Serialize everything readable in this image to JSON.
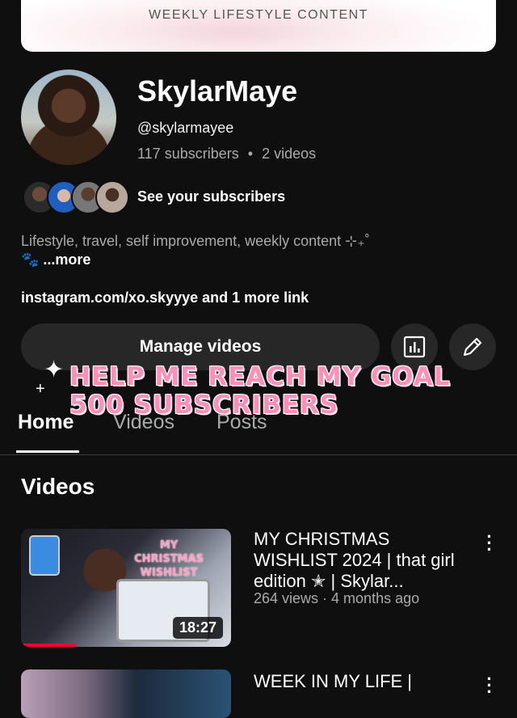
{
  "banner": {
    "tagline": "WEEKLY LIFESTYLE CONTENT"
  },
  "channel": {
    "name": "SkylarMaye",
    "handle": "@skylarmayee",
    "subscribers": "117 subscribers",
    "separator": "•",
    "videos_count": "2 videos",
    "see_subscribers": "See your subscribers",
    "description": "Lifestyle, travel, self improvement, weekly content ⊹₊˚",
    "description_more": "🐾 ...more",
    "link_text": "instagram.com/xo.skyyye and 1 more link"
  },
  "actions": {
    "manage_videos": "Manage videos",
    "analytics_icon": "analytics-icon",
    "edit_icon": "pencil-icon"
  },
  "overlay": {
    "line1": "HELP ME REACH MY GOAL",
    "line2": "500 SUBSCRIBERS"
  },
  "tabs": [
    {
      "label": "Home",
      "active": true
    },
    {
      "label": "Videos",
      "active": false
    },
    {
      "label": "Posts",
      "active": false
    }
  ],
  "section": {
    "title": "Videos"
  },
  "videos": [
    {
      "thumb_text": "MY CHRISTMAS WISHLIST",
      "duration": "18:27",
      "watched_fraction": 0.26,
      "title": "MY CHRISTMAS WISHLIST 2024 | that girl edition ✭ | Skylar...",
      "meta": "264 views · 4 months ago"
    },
    {
      "title": "WEEK IN MY LIFE |"
    }
  ],
  "colors": {
    "background": "#0f0f0f",
    "button_bg": "#272727",
    "overlay_pink": "#ff8fb6",
    "progress_red": "#ff0033"
  }
}
